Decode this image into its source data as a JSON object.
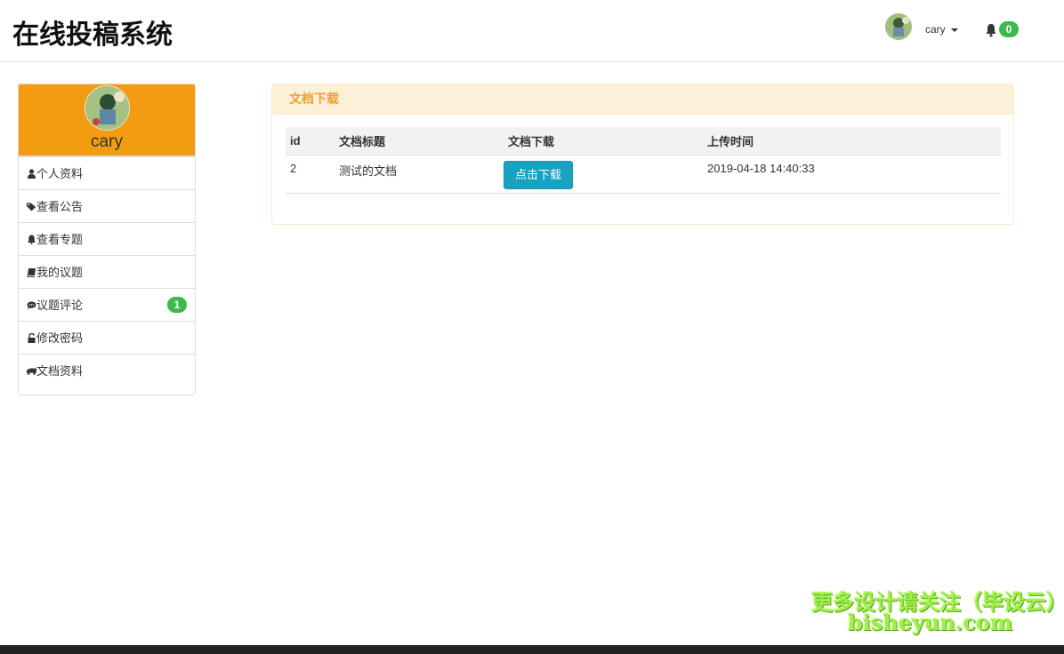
{
  "header": {
    "brand": "在线投稿系统",
    "user_name": "cary",
    "notification_count": "0"
  },
  "sidebar": {
    "profile_name": "cary",
    "items": [
      {
        "label": "个人资料",
        "icon": "user-icon"
      },
      {
        "label": "查看公告",
        "icon": "tags-icon"
      },
      {
        "label": "查看专题",
        "icon": "bell-icon"
      },
      {
        "label": "我的议题",
        "icon": "book-icon"
      },
      {
        "label": "议题评论",
        "icon": "comment-icon",
        "badge": "1"
      },
      {
        "label": "修改密码",
        "icon": "unlock-icon"
      },
      {
        "label": "文档资料",
        "icon": "truck-icon"
      }
    ]
  },
  "panel": {
    "title": "文档下载",
    "columns": [
      "id",
      "文档标题",
      "文档下载",
      "上传时间"
    ],
    "rows": [
      {
        "id": "2",
        "title": "测试的文档",
        "download_label": "点击下载",
        "uploaded": "2019-04-18 14:40:33"
      }
    ]
  },
  "watermark": {
    "line1": "更多设计请关注（毕设云）",
    "line2": "bisheyun.com"
  },
  "colors": {
    "sidebar_profile_bg": "#f39c12",
    "panel_heading_bg": "#fcf0d8",
    "panel_heading_text": "#f0a030",
    "download_button": "#17a2c0",
    "badge_green": "#3cb84c"
  }
}
